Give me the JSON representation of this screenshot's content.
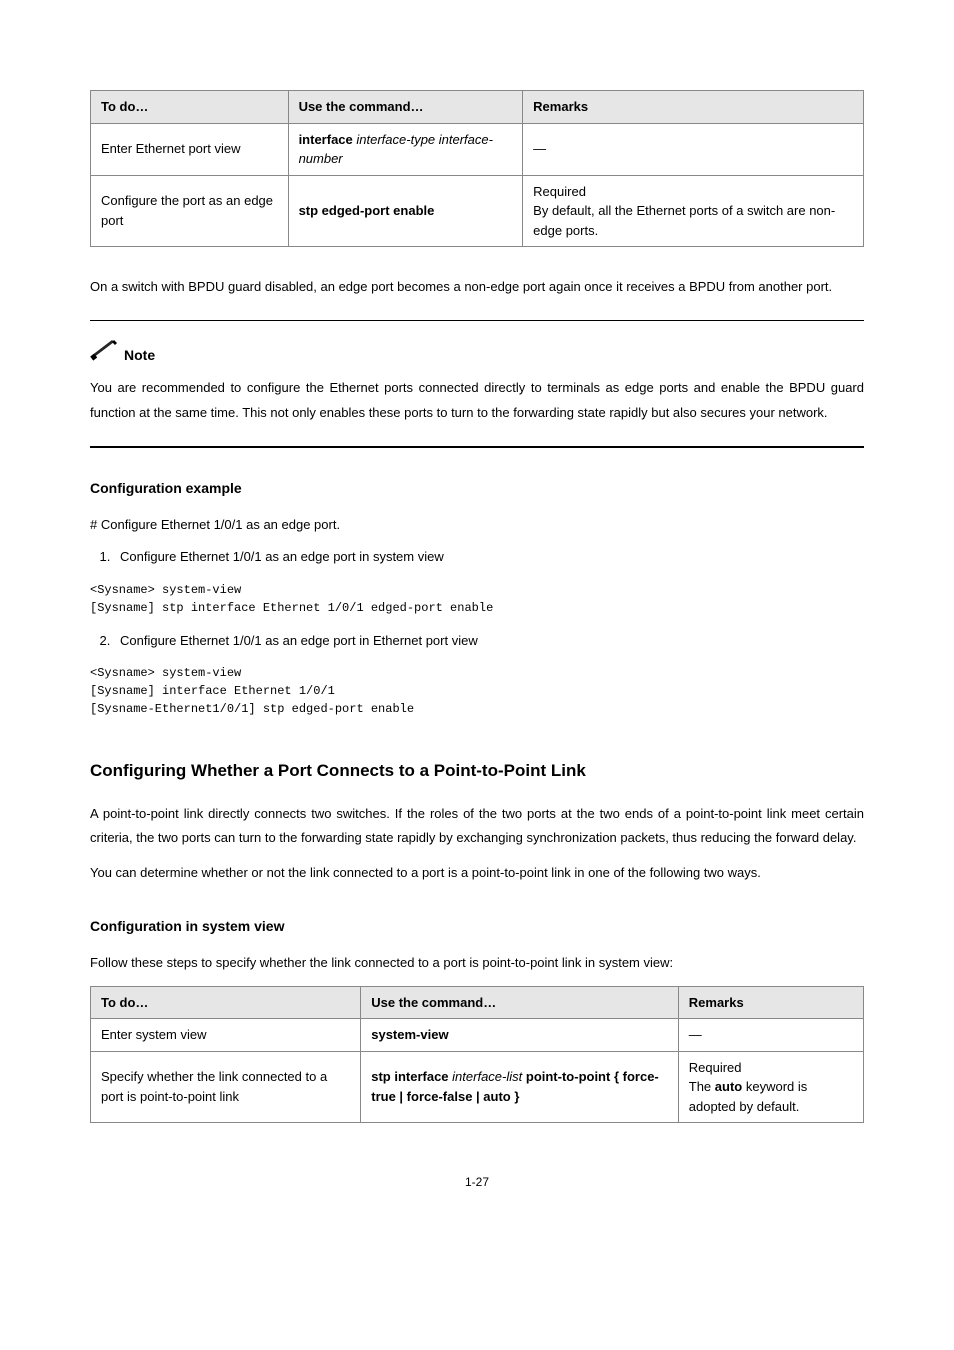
{
  "table1": {
    "headers": [
      "To do…",
      "Use the command…",
      "Remarks"
    ],
    "rows": [
      {
        "todo": "Enter Ethernet port view",
        "cmd_bold": "interface",
        "cmd_var": "interface-type interface-number",
        "remarks": "—"
      },
      {
        "todo": "Configure the port as an edge port",
        "cmd_bold": "stp edged-port enable",
        "cmd_var": "",
        "remarks_line1": "Required",
        "remarks_line2": "By default, all the Ethernet ports of a switch are non-edge ports."
      }
    ]
  },
  "para1": "On a switch with BPDU guard disabled, an edge port becomes a non-edge port again once it receives a BPDU from another port.",
  "note_label": "Note",
  "note_body": "You are recommended to configure the Ethernet ports connected directly to terminals as edge ports and enable the BPDU guard function at the same time. This not only enables these ports to turn to the forwarding state rapidly but also secures your network.",
  "heading_config_example": "Configuration example",
  "example_intro": "# Configure Ethernet 1/0/1 as an edge port.",
  "example_item1": "Configure Ethernet 1/0/1 as an edge port in system view",
  "code1": "<Sysname> system-view\n[Sysname] stp interface Ethernet 1/0/1 edged-port enable",
  "example_item2": "Configure Ethernet 1/0/1 as an edge port in Ethernet port view",
  "code2": "<Sysname> system-view\n[Sysname] interface Ethernet 1/0/1\n[Sysname-Ethernet1/0/1] stp edged-port enable",
  "heading_p2p": "Configuring Whether a Port Connects to a Point-to-Point Link",
  "p2p_para1": "A point-to-point link directly connects two switches. If the roles of the two ports at the two ends of a point-to-point link meet certain criteria, the two ports can turn to the forwarding state rapidly by exchanging synchronization packets, thus reducing the forward delay.",
  "p2p_para2": "You can determine whether or not the link connected to a port is a point-to-point link in one of the following two ways.",
  "heading_sysview": "Configuration in system view",
  "table2_intro": "Follow these steps to specify whether the link connected to a port is point-to-point link in system view:",
  "table2": {
    "headers": [
      "To do…",
      "Use the command…",
      "Remarks"
    ],
    "rows": [
      {
        "todo": "Enter system view",
        "cmd_bold": "system-view",
        "cmd_var": "",
        "remarks": "—"
      },
      {
        "todo": "Specify whether the link connected to a port is point-to-point link",
        "cmd_b1": "stp interface",
        "cmd_v1": "interface-list",
        "cmd_b2": "point-to-point",
        "cmd_b3": "force-true",
        "cmd_b4": "force-false",
        "cmd_b5": "auto",
        "remarks_line1": "Required",
        "remarks_line2a": "The ",
        "remarks_line2b": "auto",
        "remarks_line2c": " keyword is adopted by default."
      }
    ]
  },
  "page_number": "1-27"
}
